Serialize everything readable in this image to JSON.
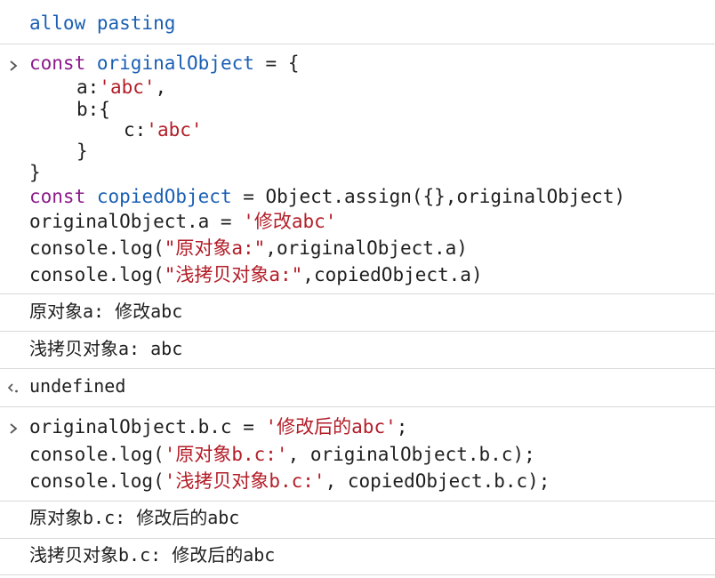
{
  "header": {
    "warning_text": "allow pasting"
  },
  "input1": {
    "l1_kw": "const",
    "l1_var": "originalObject",
    "l1_rest": " = {",
    "l2_key": "a:",
    "l2_str": "'abc'",
    "l2_rest": ",",
    "l3": "b:{",
    "l4_key": "c:",
    "l4_str": "'abc'",
    "l5": "}",
    "l6": "}",
    "l7_kw": "const",
    "l7_var": "copiedObject",
    "l7_rest": " = Object.assign({},originalObject)",
    "l8_pre": "originalObject.a = ",
    "l8_str": "'修改abc'",
    "l9_pre": "console.log(",
    "l9_str": "\"原对象a:\"",
    "l9_post": ",originalObject.a)",
    "l10_pre": "console.log(",
    "l10_str": "\"浅拷贝对象a:\"",
    "l10_post": ",copiedObject.a)"
  },
  "output1": {
    "log1": "原对象a: 修改abc",
    "log2": "浅拷贝对象a: abc",
    "result": "undefined"
  },
  "input2": {
    "l1_pre": "originalObject.b.c = ",
    "l1_str": "'修改后的abc'",
    "l1_post": ";",
    "l2_pre": "console.log(",
    "l2_str": "'原对象b.c:'",
    "l2_post": ", originalObject.b.c);",
    "l3_pre": "console.log(",
    "l3_str": "'浅拷贝对象b.c:'",
    "l3_post": ", copiedObject.b.c);"
  },
  "output2": {
    "log1": "原对象b.c: 修改后的abc",
    "log2": "浅拷贝对象b.c: 修改后的abc"
  }
}
